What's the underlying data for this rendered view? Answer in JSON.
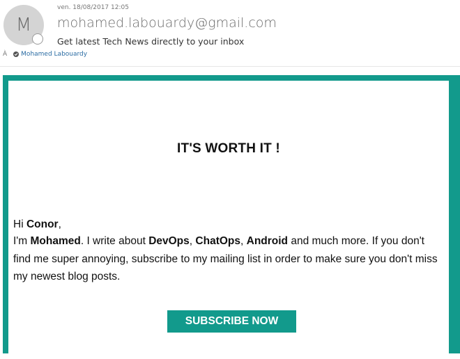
{
  "header": {
    "avatar_initial": "M",
    "date": "ven. 18/08/2017 12:05",
    "sender": "mohamed.labouardy@gmail.com",
    "subject": "Get latest Tech News directly to your inbox",
    "to_label": "À",
    "recipient": "Mohamed Labouardy",
    "icons": {
      "presence": "presence-status-icon",
      "recipient": "verified-check-icon"
    }
  },
  "email": {
    "headline": "IT'S WORTH IT !",
    "greeting_prefix": "Hi ",
    "greeting_name": "Conor",
    "greeting_suffix": ",",
    "intro": {
      "part1": "I'm ",
      "name": "Mohamed",
      "part2": ". I write about ",
      "topic1": "DevOps",
      "sep1": ", ",
      "topic2": "ChatOps",
      "sep2": ", ",
      "topic3": "Android",
      "part3": " and much more. If you don't find me super annoying, subscribe to my mailing list in order to make sure you don't miss my newest blog posts."
    },
    "cta_label": "SUBSCRIBE NOW"
  },
  "colors": {
    "accent": "#129a8c",
    "link": "#2b6ca3",
    "avatar_bg": "#d4d4d4"
  }
}
